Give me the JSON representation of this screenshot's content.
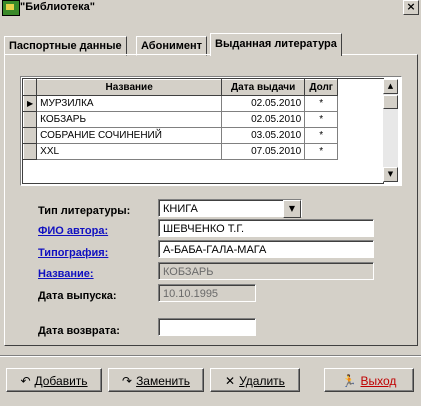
{
  "window": {
    "title": "\"Библиотека\""
  },
  "tabs": [
    {
      "label": "Паспортные данные"
    },
    {
      "label": "Абонимент"
    },
    {
      "label": "Выданная литература"
    }
  ],
  "grid": {
    "columns": [
      "Название",
      "Дата выдачи",
      "Долг"
    ],
    "rows": [
      {
        "name": "МУРЗИЛКА",
        "date": "02.05.2010",
        "debt": "*"
      },
      {
        "name": "КОБЗАРЬ",
        "date": "02.05.2010",
        "debt": "*"
      },
      {
        "name": "СОБРАНИЕ СОЧИНЕНИЙ",
        "date": "03.05.2010",
        "debt": "*"
      },
      {
        "name": "XXL",
        "date": "07.05.2010",
        "debt": "*"
      }
    ]
  },
  "form": {
    "type_label": "Тип литературы:",
    "type_value": "КНИГА",
    "author_label": "ФИО автора:",
    "author_value": "ШЕВЧЕНКО Т.Г.",
    "printer_label": "Типография:",
    "printer_value": "А-БАБА-ГАЛА-МАГА",
    "title_label": "Название:",
    "title_value": "КОБЗАРЬ",
    "release_label": "Дата выпуска:",
    "release_value": "10.10.1995",
    "return_label": "Дата возврата:",
    "return_value": ""
  },
  "buttons": {
    "add": "Добавить",
    "replace": "Заменить",
    "delete": "Удалить",
    "exit": "Выход"
  }
}
